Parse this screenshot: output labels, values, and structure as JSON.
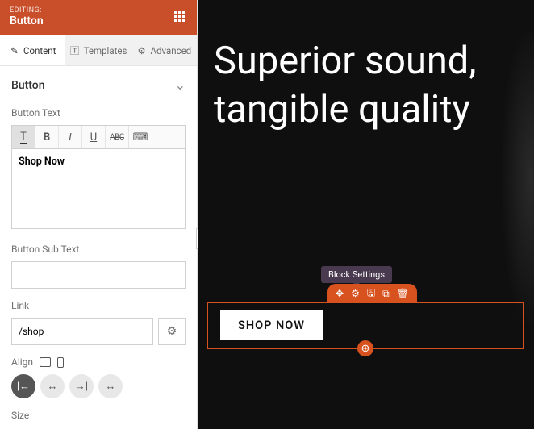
{
  "header": {
    "editing_label": "EDITING:",
    "element_name": "Button"
  },
  "tabs": {
    "content": "Content",
    "templates": "Templates",
    "advanced": "Advanced"
  },
  "section": {
    "title": "Button"
  },
  "fields": {
    "button_text_label": "Button Text",
    "button_text_value": "Shop Now",
    "sub_text_label": "Button Sub Text",
    "sub_text_value": "",
    "link_label": "Link",
    "link_value": "/shop",
    "align_label": "Align",
    "size_label": "Size"
  },
  "rte": {
    "text_btn": "T",
    "bold": "B",
    "italic": "I",
    "underline": "U",
    "strike": "ABC",
    "keyboard": "⌨"
  },
  "canvas": {
    "hero": "Superior sound, tangible quality",
    "button_label": "SHOP NOW",
    "tooltip": "Block Settings",
    "add": "⊕"
  },
  "colors": {
    "accent": "#d8521f",
    "header": "#c94e2a"
  }
}
